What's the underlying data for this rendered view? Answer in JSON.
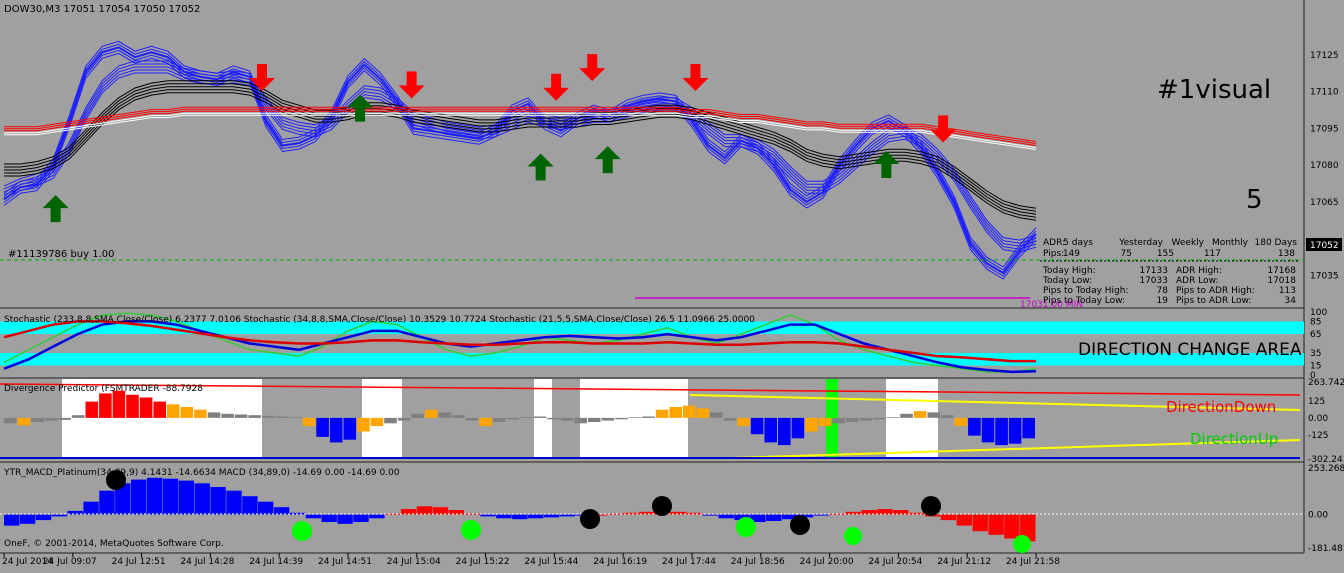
{
  "window": {
    "symbol_title": "DOW30,M3  17051 17054 17050 17052",
    "copyright": "OneF, © 2001-2014, MetaQuotes Software Corp."
  },
  "colors": {
    "background": "#a0a0a0",
    "bull_arrow": "#006400",
    "bear_arrow": "#ff0000",
    "fast_ma": "#2020ff",
    "slow_ma": "#000000",
    "red_ma": "#ff0000",
    "white_ma": "#ffffff",
    "stoch_band": "#00ffff",
    "div_up": "#ff0000",
    "div_down": "#ffa500",
    "div_gray": "#808080",
    "macd_pos": "#ff0000",
    "macd_neg": "#0000ff",
    "signal_dot": "#00ff00",
    "yellow_line": "#ffff00",
    "magenta_line": "#cc00cc"
  },
  "labels": {
    "visual_tag": "#1visual",
    "five": "5",
    "order_text": "#11139786 buy 1.00",
    "low_marker": "17031.00 MIN",
    "direction_change": "DIRECTION CHANGE AREA",
    "direction_down": "DirectionDown",
    "direction_up": "DirectionUp"
  },
  "adr_panel": {
    "header": [
      "ADR:",
      "5 days",
      "Yesterday",
      "Weekly",
      "Monthly",
      "180 Days"
    ],
    "pips_row": [
      "Pips:",
      "149",
      "75",
      "155",
      "117",
      "138"
    ],
    "rows": [
      {
        "l1": "Today High:",
        "v1": "17133",
        "l2": "ADR High:",
        "v2": "17168"
      },
      {
        "l1": "Today Low:",
        "v1": "17033",
        "l2": "ADR Low:",
        "v2": "17018"
      },
      {
        "l1": "Pips to Today High:",
        "v1": "78",
        "l2": "Pips to ADR High:",
        "v2": "113"
      },
      {
        "l1": "Pips to Today Low:",
        "v1": "19",
        "l2": "Pips to ADR Low:",
        "v2": "34"
      }
    ]
  },
  "chart_data": [
    {
      "type": "line",
      "title": "DOW30,M3  17051 17054 17050 17052",
      "ylim": [
        17025,
        17140
      ],
      "yticks": [
        "17125",
        "17110",
        "17095",
        "17080",
        "17065",
        "17052",
        "17035"
      ],
      "yticks_values": [
        17125,
        17110,
        17095,
        17080,
        17065,
        17052,
        17035
      ],
      "current_price": 17052,
      "order_line_price": 17052,
      "min_line_price": 17031,
      "series": [
        {
          "values": [
            17066,
            17071,
            17072,
            17080,
            17098,
            17118,
            17126,
            17128,
            17124,
            17126,
            17124,
            17118,
            17116,
            17115,
            17118,
            17116,
            17098,
            17088,
            17089,
            17092,
            17100,
            17114,
            17121,
            17115,
            17106,
            17095,
            17094,
            17093,
            17092,
            17091,
            17094,
            17102,
            17105,
            17097,
            17094,
            17099,
            17102,
            17100,
            17104,
            17106,
            17107,
            17106,
            17098,
            17088,
            17083,
            17090,
            17087,
            17080,
            17070,
            17065,
            17069,
            17080,
            17088,
            17095,
            17098,
            17094,
            17087,
            17077,
            17065,
            17048,
            17040,
            17036,
            17045,
            17052
          ]
        },
        {
          "values": [
            17069,
            17072,
            17074,
            17077,
            17087,
            17101,
            17112,
            17118,
            17120,
            17120,
            17120,
            17117,
            17116,
            17115,
            17116,
            17115,
            17105,
            17097,
            17095,
            17094,
            17097,
            17104,
            17110,
            17109,
            17105,
            17099,
            17097,
            17095,
            17094,
            17093,
            17094,
            17097,
            17100,
            17098,
            17097,
            17098,
            17100,
            17100,
            17102,
            17104,
            17105,
            17105,
            17101,
            17095,
            17090,
            17090,
            17088,
            17084,
            17077,
            17071,
            17071,
            17075,
            17081,
            17087,
            17092,
            17093,
            17090,
            17084,
            17076,
            17065,
            17055,
            17048,
            17047,
            17049
          ]
        },
        {
          "values": [
            17078,
            17078,
            17079,
            17081,
            17085,
            17092,
            17099,
            17105,
            17109,
            17111,
            17112,
            17112,
            17112,
            17112,
            17112,
            17111,
            17108,
            17104,
            17102,
            17100,
            17100,
            17101,
            17103,
            17103,
            17102,
            17100,
            17099,
            17098,
            17097,
            17096,
            17096,
            17097,
            17098,
            17098,
            17098,
            17098,
            17099,
            17099,
            17100,
            17101,
            17102,
            17102,
            17101,
            17099,
            17097,
            17095,
            17093,
            17091,
            17088,
            17084,
            17082,
            17081,
            17082,
            17083,
            17084,
            17084,
            17083,
            17081,
            17077,
            17072,
            17067,
            17063,
            17061,
            17060
          ]
        },
        {
          "values": [
            17094,
            17094,
            17094,
            17095,
            17096,
            17097,
            17098,
            17099,
            17100,
            17101,
            17101,
            17102,
            17102,
            17102,
            17102,
            17102,
            17102,
            17102,
            17102,
            17102,
            17102,
            17102,
            17102,
            17102,
            17102,
            17102,
            17102,
            17102,
            17102,
            17102,
            17102,
            17102,
            17102,
            17102,
            17102,
            17102,
            17102,
            17102,
            17102,
            17102,
            17102,
            17102,
            17101,
            17101,
            17100,
            17099,
            17099,
            17098,
            17097,
            17096,
            17096,
            17095,
            17095,
            17095,
            17095,
            17095,
            17095,
            17094,
            17093,
            17092,
            17091,
            17090,
            17089,
            17088
          ]
        }
      ],
      "arrows_up_x": [
        0.05,
        0.345,
        0.52,
        0.585,
        0.855
      ],
      "arrows_down_x": [
        0.25,
        0.395,
        0.535,
        0.57,
        0.67,
        0.91
      ]
    },
    {
      "type": "line",
      "title": "Stochastic (233,8,8,SMA,Close/Close) 6.2377 7.0106  Stochastic (34,8,8,SMA,Close/Close) 10.3529 10.7724  Stochastic (21,5,5,SMA,Close/Close) 26.5 11.0966 25.0000",
      "ylim": [
        0,
        100
      ],
      "yticks": [
        "100",
        "85",
        "65",
        "35",
        "15",
        "0"
      ],
      "yticks_values": [
        100,
        85,
        65,
        35,
        15,
        0
      ],
      "band_high": [
        65,
        85
      ],
      "band_low": [
        15,
        35
      ],
      "series": [
        {
          "values": [
            20,
            40,
            60,
            80,
            95,
            98,
            95,
            85,
            70,
            55,
            40,
            35,
            30,
            45,
            70,
            85,
            80,
            60,
            40,
            30,
            35,
            45,
            60,
            55,
            50,
            55,
            65,
            75,
            60,
            50,
            65,
            80,
            95,
            80,
            55,
            40,
            30,
            20,
            15,
            10,
            5,
            5,
            10
          ]
        },
        {
          "values": [
            10,
            25,
            45,
            65,
            80,
            85,
            85,
            80,
            70,
            60,
            50,
            45,
            40,
            50,
            60,
            70,
            70,
            60,
            50,
            45,
            50,
            55,
            60,
            62,
            60,
            58,
            60,
            65,
            60,
            55,
            60,
            70,
            80,
            80,
            65,
            50,
            40,
            30,
            20,
            12,
            8,
            5,
            6
          ]
        },
        {
          "values": [
            60,
            70,
            80,
            85,
            85,
            82,
            78,
            72,
            66,
            60,
            55,
            52,
            50,
            50,
            52,
            55,
            55,
            52,
            50,
            48,
            48,
            50,
            52,
            52,
            50,
            50,
            50,
            52,
            50,
            48,
            48,
            50,
            52,
            52,
            50,
            45,
            40,
            35,
            30,
            28,
            25,
            22,
            22
          ]
        }
      ]
    },
    {
      "type": "bar",
      "title": "Divergence Predictor (FSMTRADER -88.7928",
      "ylim": [
        -302.241,
        263.7423
      ],
      "yticks": [
        "263.7423",
        "125",
        "0.00",
        "-125",
        "-302.241"
      ],
      "yticks_values": [
        263.7423,
        125,
        0,
        -125,
        -302.241
      ],
      "values": [
        -40,
        -55,
        -30,
        -20,
        -15,
        20,
        120,
        180,
        200,
        170,
        150,
        120,
        100,
        80,
        60,
        40,
        30,
        25,
        20,
        15,
        10,
        5,
        -60,
        -140,
        -180,
        -160,
        -100,
        -60,
        -40,
        -20,
        30,
        60,
        40,
        20,
        -20,
        -60,
        -30,
        -10,
        5,
        10,
        -10,
        -20,
        -40,
        -30,
        -20,
        -10,
        5,
        10,
        60,
        80,
        90,
        70,
        40,
        -20,
        -60,
        -120,
        -180,
        -200,
        -150,
        -100,
        -60,
        -40,
        -30,
        -20,
        -10,
        5,
        30,
        50,
        40,
        20,
        -60,
        -130,
        -180,
        -200,
        -190,
        -150
      ]
    },
    {
      "type": "bar",
      "title": "YTR_MACD_Platinum(34,89,9) 4.1431 -14.6634  MACD (34,89,0) -14.69 0.00 -14.69 0.00",
      "ylim": [
        -181.481,
        253.2686
      ],
      "yticks": [
        "253.2686",
        "0.00",
        "-181.481"
      ],
      "yticks_values": [
        253.2686,
        0,
        -181.481
      ],
      "values": [
        -60,
        -50,
        -30,
        -10,
        20,
        70,
        130,
        170,
        190,
        200,
        195,
        185,
        170,
        150,
        130,
        100,
        70,
        40,
        10,
        -20,
        -40,
        -50,
        -40,
        -20,
        5,
        30,
        45,
        40,
        25,
        5,
        -10,
        -20,
        -25,
        -20,
        -15,
        -10,
        -5,
        0,
        5,
        10,
        15,
        20,
        15,
        10,
        -5,
        -20,
        -30,
        -40,
        -35,
        -25,
        -15,
        -5,
        5,
        15,
        25,
        30,
        25,
        10,
        -10,
        -30,
        -60,
        -90,
        -110,
        -130,
        -145
      ]
    }
  ],
  "xaxis": {
    "labels": [
      "24 Jul 2014",
      "24 Jul 09:07",
      "24 Jul 12:51",
      "24 Jul 14:28",
      "24 Jul 14:39",
      "24 Jul 14:51",
      "24 Jul 15:04",
      "24 Jul 15:22",
      "24 Jul 15:44",
      "24 Jul 16:19",
      "24 Jul 17:44",
      "24 Jul 18:56",
      "24 Jul 20:00",
      "24 Jul 20:54",
      "24 Jul 21:12",
      "24 Jul 21:58"
    ]
  }
}
